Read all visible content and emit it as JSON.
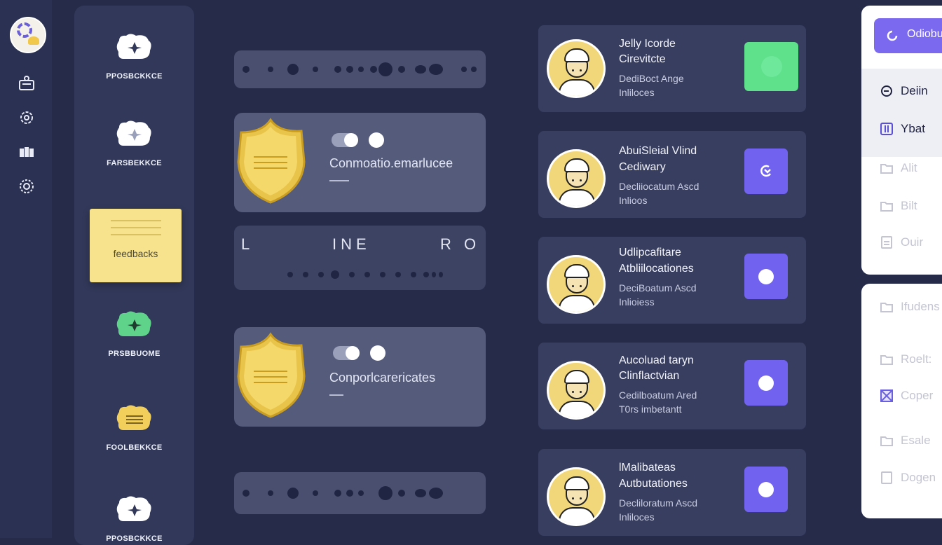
{
  "feedback_panel": {
    "items": [
      {
        "label": "PPOSBCKKCE",
        "icon": "speech-bubble-icon",
        "color": "#ffffff"
      },
      {
        "label": "FARSBEKKCE",
        "icon": "speech-bubble-icon",
        "color": "#ffffff"
      },
      {
        "label": "PRSBBUOME",
        "icon": "speech-bubble-icon",
        "color": "#5fd38a"
      },
      {
        "label": "FOOLBEKKCE",
        "icon": "notes-bubble-icon",
        "color": "#f2cf5b"
      },
      {
        "label": "PPOSBCKKCE",
        "icon": "speech-bubble-icon",
        "color": "#ffffff"
      }
    ],
    "active_note": {
      "label": "feedbacks"
    }
  },
  "middle": {
    "cards": [
      {
        "title": "Conmoatio.emarlucee"
      },
      {
        "title": "Conporlcarericates"
      }
    ],
    "letter_row": {
      "left": "L",
      "middle": "INE",
      "right": "R O"
    }
  },
  "profiles": [
    {
      "name1": "Jelly Icorde",
      "name2": "Cirevitcte",
      "sub1": "DediBoct Ange",
      "sub2": "Inliloces",
      "button_color": "#5fe08a",
      "button_icon": "circle-icon"
    },
    {
      "name1": "AbuiSleial Vlind",
      "name2": "Cediwary",
      "sub1": "Decliiocatum Ascd",
      "sub2": "Inlioos",
      "button_color": "#7262f0",
      "button_icon": "undo-icon"
    },
    {
      "name1": "Udlipcafitare",
      "name2": "Atbliilocationes",
      "sub1": "DeciBoatum Ascd",
      "sub2": "Inlioiess",
      "button_color": "#7262f0",
      "button_icon": "circle-icon"
    },
    {
      "name1": "Aucoluad taryn",
      "name2": "Clinflactvian",
      "sub1": "Cedilboatum Ared",
      "sub2": "T0rs imbetantt",
      "button_color": "#7262f0",
      "button_icon": "circle-icon"
    },
    {
      "name1": "lMalibateas",
      "name2": "Autbutationes",
      "sub1": "Decliloratum Ascd",
      "sub2": "Inliloces",
      "button_color": "#7262f0",
      "button_icon": "circle-icon"
    }
  ],
  "right_menu": {
    "top_button": "Odiobu",
    "items": [
      {
        "label": "Deiin",
        "icon": "clock-icon"
      },
      {
        "label": "Ybat",
        "icon": "book-icon"
      },
      {
        "label": "Alit",
        "icon": "folder-icon"
      },
      {
        "label": "Bilt",
        "icon": "folder-icon"
      },
      {
        "label": "Ouir",
        "icon": "document-icon"
      }
    ],
    "items2": [
      {
        "label": "Ifudens",
        "icon": "folder-icon"
      },
      {
        "label": "Roelt:",
        "icon": "folder-icon"
      },
      {
        "label": "Coper",
        "icon": "close-box-icon"
      },
      {
        "label": "Esale",
        "icon": "folder-icon"
      },
      {
        "label": "Dogen",
        "icon": "document-icon"
      }
    ]
  },
  "colors": {
    "accent": "#7b6af0",
    "green": "#5fe08a",
    "shield": "#f0cf57"
  }
}
